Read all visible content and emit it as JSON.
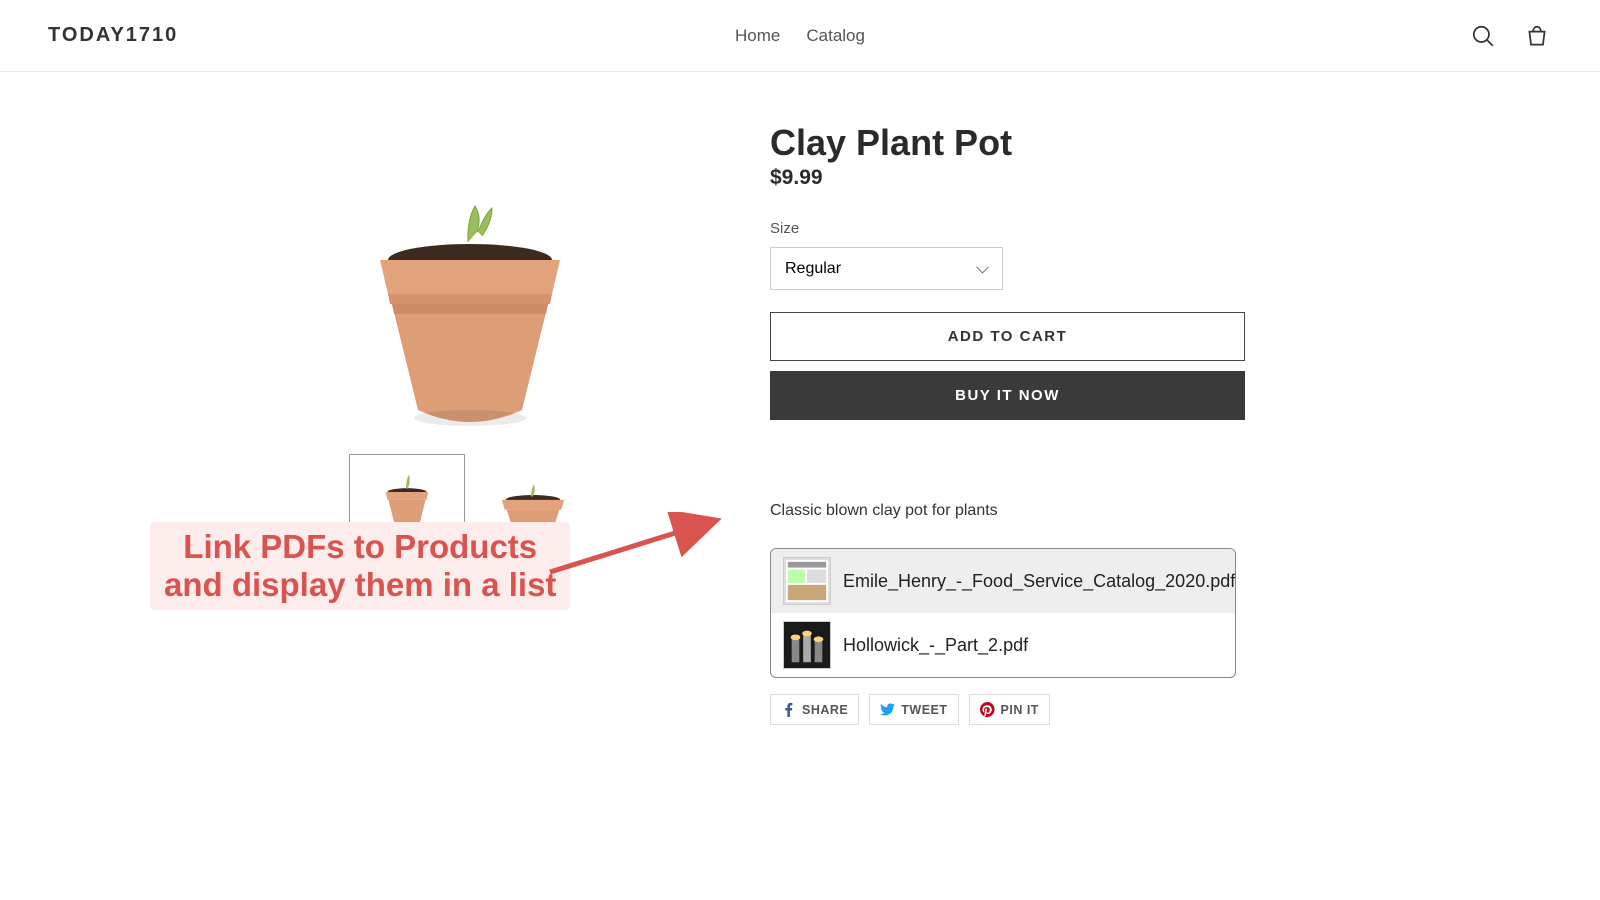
{
  "header": {
    "logo": "TODAY1710",
    "nav": {
      "home": "Home",
      "catalog": "Catalog"
    }
  },
  "product": {
    "title": "Clay Plant Pot",
    "price": "$9.99",
    "size_label": "Size",
    "size_value": "Regular",
    "add_to_cart": "ADD TO CART",
    "buy_now": "BUY IT NOW",
    "description": "Classic blown clay pot for plants"
  },
  "pdfs": [
    {
      "name": "Emile_Henry_-_Food_Service_Catalog_2020.pdf"
    },
    {
      "name": "Hollowick_-_Part_2.pdf"
    }
  ],
  "share": {
    "facebook": "SHARE",
    "twitter": "TWEET",
    "pinterest": "PIN IT"
  },
  "annotation": {
    "line1": "Link PDFs to Products",
    "line2": "and display them in a list"
  }
}
